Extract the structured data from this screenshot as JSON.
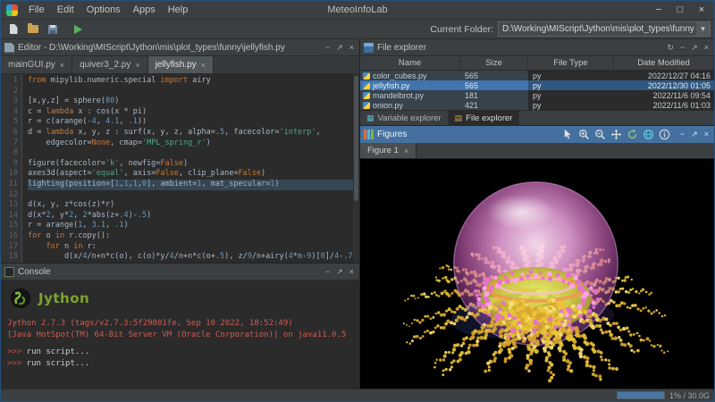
{
  "menubar": {
    "app_title": "MeteoInfoLab",
    "items": [
      "File",
      "Edit",
      "Options",
      "Apps",
      "Help"
    ],
    "window_controls": [
      {
        "name": "minimize-window",
        "glyph": "−"
      },
      {
        "name": "maximize-window",
        "glyph": "□"
      },
      {
        "name": "close-window",
        "glyph": "×"
      }
    ]
  },
  "toolbar": {
    "current_folder_label": "Current Folder:",
    "current_folder_path": "D:\\Working\\MIScript\\Jython\\mis\\plot_types\\funny"
  },
  "glyphs": {
    "minimize": "−",
    "float": "↗",
    "close": "×",
    "refresh": "↻",
    "dropdown": "▾",
    "tab_close": "×"
  },
  "editor": {
    "title": "Editor - D:\\Working\\MIScript\\Jython\\mis\\plot_types\\funny\\jellyfish.py",
    "controls": [
      "minimize",
      "float",
      "close"
    ],
    "tabs": [
      {
        "label": "mainGUI.py",
        "active": false
      },
      {
        "label": "quiver3_2.py",
        "active": false
      },
      {
        "label": "jellyfish.py",
        "active": true
      }
    ],
    "code": [
      {
        "t": [
          [
            "kw",
            "from"
          ],
          [
            "pl",
            " mipylib.numeric.special "
          ],
          [
            "kw",
            "import"
          ],
          [
            "pl",
            " airy"
          ]
        ]
      },
      {
        "t": []
      },
      {
        "t": [
          [
            "pl",
            "[x,y,z] = sphere("
          ],
          [
            "num",
            "80"
          ],
          [
            "pl",
            ")"
          ]
        ]
      },
      {
        "t": [
          [
            "pl",
            "c = "
          ],
          [
            "kw",
            "lambda"
          ],
          [
            "pl",
            " x : cos(x * pi)"
          ]
        ]
      },
      {
        "t": [
          [
            "pl",
            "r = c(arange("
          ],
          [
            "num",
            "-4"
          ],
          [
            "pl",
            ", "
          ],
          [
            "num",
            "4.1"
          ],
          [
            "pl",
            ", "
          ],
          [
            "num",
            ".1"
          ],
          [
            "pl",
            "))"
          ]
        ]
      },
      {
        "t": [
          [
            "pl",
            "d = "
          ],
          [
            "kw",
            "lambda"
          ],
          [
            "pl",
            " x, y, z : surf(x, y, z, alpha="
          ],
          [
            "num",
            ".5"
          ],
          [
            "pl",
            ", facecolor="
          ],
          [
            "str",
            "'interp'"
          ],
          [
            "pl",
            ","
          ]
        ]
      },
      {
        "t": [
          [
            "pl",
            "    edgecolor="
          ],
          [
            "kw",
            "None"
          ],
          [
            "pl",
            ", cmap="
          ],
          [
            "str",
            "'MPL_spring_r'"
          ],
          [
            "pl",
            ")"
          ]
        ]
      },
      {
        "t": []
      },
      {
        "t": [
          [
            "pl",
            "figure(facecolor="
          ],
          [
            "str",
            "'k'"
          ],
          [
            "pl",
            ", newfig="
          ],
          [
            "kw",
            "False"
          ],
          [
            "pl",
            ")"
          ]
        ]
      },
      {
        "t": [
          [
            "pl",
            "axes3d(aspect="
          ],
          [
            "str",
            "'equal'"
          ],
          [
            "pl",
            ", axis="
          ],
          [
            "kw",
            "False"
          ],
          [
            "pl",
            ", clip_plane="
          ],
          [
            "kw",
            "False"
          ],
          [
            "pl",
            ")"
          ]
        ]
      },
      {
        "hl": true,
        "t": [
          [
            "pl",
            "lighting(position=["
          ],
          [
            "num",
            "1"
          ],
          [
            "pl",
            ","
          ],
          [
            "num",
            "1"
          ],
          [
            "pl",
            ","
          ],
          [
            "num",
            "1"
          ],
          [
            "pl",
            ","
          ],
          [
            "num",
            "0"
          ],
          [
            "pl",
            "], ambient="
          ],
          [
            "num",
            "1"
          ],
          [
            "pl",
            ", mat_specular="
          ],
          [
            "num",
            "1"
          ],
          [
            "pl",
            ")"
          ]
        ]
      },
      {
        "t": []
      },
      {
        "t": [
          [
            "pl",
            "d(x, y, z*cos(z)*r)"
          ]
        ]
      },
      {
        "t": [
          [
            "pl",
            "d(x*"
          ],
          [
            "num",
            "2"
          ],
          [
            "pl",
            ", y*"
          ],
          [
            "num",
            "2"
          ],
          [
            "pl",
            ", "
          ],
          [
            "num",
            "2"
          ],
          [
            "pl",
            "*abs(z+"
          ],
          [
            "num",
            ".4"
          ],
          [
            "pl",
            ")-"
          ],
          [
            "num",
            ".5"
          ],
          [
            "pl",
            ")"
          ]
        ]
      },
      {
        "t": [
          [
            "pl",
            "r = arange("
          ],
          [
            "num",
            "1"
          ],
          [
            "pl",
            ", "
          ],
          [
            "num",
            "3.1"
          ],
          [
            "pl",
            ", "
          ],
          [
            "num",
            ".1"
          ],
          [
            "pl",
            ")"
          ]
        ]
      },
      {
        "t": [
          [
            "kw",
            "for"
          ],
          [
            "pl",
            " o "
          ],
          [
            "kw",
            "in"
          ],
          [
            "pl",
            " r.copy():"
          ]
        ]
      },
      {
        "t": [
          [
            "pl",
            "    "
          ],
          [
            "kw",
            "for"
          ],
          [
            "pl",
            " n "
          ],
          [
            "kw",
            "in"
          ],
          [
            "pl",
            " r:"
          ]
        ]
      },
      {
        "t": [
          [
            "pl",
            "        d(x/"
          ],
          [
            "num",
            "4"
          ],
          [
            "pl",
            "/n+n*c(o), c(o)*y/"
          ],
          [
            "num",
            "4"
          ],
          [
            "pl",
            "/n+n*c(o+"
          ],
          [
            "num",
            ".5"
          ],
          [
            "pl",
            "), z/"
          ],
          [
            "num",
            "9"
          ],
          [
            "pl",
            "/n+airy("
          ],
          [
            "num",
            "4"
          ],
          [
            "pl",
            "*n-"
          ],
          [
            "num",
            "9"
          ],
          [
            "pl",
            ")["
          ],
          [
            "num",
            "0"
          ],
          [
            "pl",
            "]/"
          ],
          [
            "num",
            "4"
          ],
          [
            "pl",
            "-"
          ],
          [
            "num",
            ".7"
          ],
          [
            "pl",
            ")"
          ]
        ]
      }
    ]
  },
  "console": {
    "title": "Console",
    "controls": [
      "minimize",
      "float",
      "close"
    ],
    "logo_text": "Jython",
    "banner_lines": [
      "Jython 2.7.3 (tags/v2.7.3:5f29801fe, Sep 10 2022, 18:52:49)",
      "[Java HotSpot(TM) 64-Bit Server VM (Oracle Corporation)] on java11.0.5"
    ],
    "prompt_lines": [
      {
        "prompt": ">>>",
        "text": "run script..."
      },
      {
        "prompt": ">>>",
        "text": "run script..."
      }
    ]
  },
  "file_explorer": {
    "title": "File explorer",
    "controls": [
      "refresh",
      "minimize",
      "float",
      "close"
    ],
    "columns": [
      "Name",
      "Size",
      "File Type",
      "Date Modified"
    ],
    "rows": [
      {
        "name": "color_cubes.py",
        "size": "565",
        "type": "py",
        "date": "2022/12/27 04:16",
        "selected": false
      },
      {
        "name": "jellyfish.py",
        "size": "565",
        "type": "py",
        "date": "2022/12/30 01:05",
        "selected": true
      },
      {
        "name": "mandelbrot.py",
        "size": "181",
        "type": "py",
        "date": "2022/11/6 09:54",
        "selected": false
      },
      {
        "name": "onion.py",
        "size": "421",
        "type": "py",
        "date": "2022/11/6 01:03",
        "selected": false
      }
    ],
    "dock_tabs": [
      {
        "label": "Variable explorer",
        "icon_name": "variable-explorer-icon",
        "icon_glyph": "▦",
        "icon_color": "#58b5c9",
        "active": false
      },
      {
        "label": "File explorer",
        "icon_name": "file-explorer-icon",
        "icon_glyph": "▤",
        "icon_color": "#c9a353",
        "active": true
      }
    ]
  },
  "figures": {
    "title": "Figures",
    "toolbar_icons": [
      "select-arrow",
      "zoom-in",
      "zoom-out",
      "pan",
      "rotate",
      "globe",
      "info"
    ],
    "controls": [
      "minimize",
      "float",
      "close"
    ],
    "tab_label": "Figure 1"
  },
  "statusbar": {
    "memory_text": "1% / 30.0G"
  },
  "colors": {
    "accent_blue": "#44709f",
    "selection_blue": "#3f74ae",
    "run_green": "#59b75c",
    "console_red": "#cf5b52",
    "keyword_orange": "#cc7832",
    "string_green": "#4fa889",
    "number_blue": "#6897bb"
  }
}
